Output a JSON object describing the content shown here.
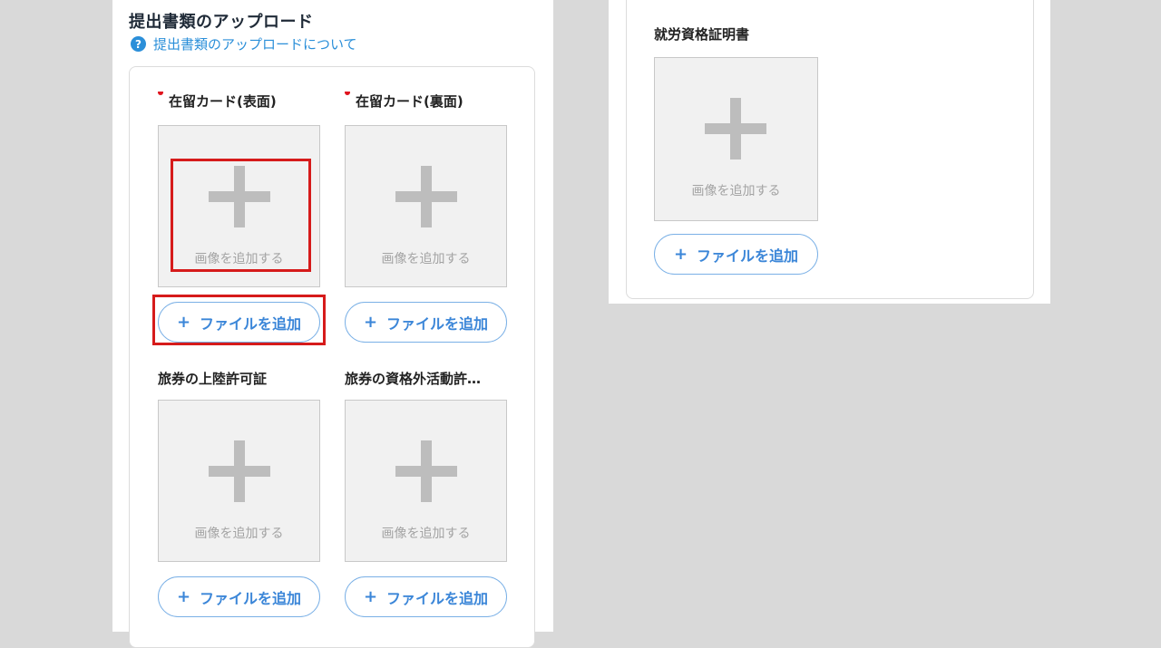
{
  "section": {
    "title": "提出書類のアップロード",
    "help_link": "提出書類のアップロードについて",
    "help_icon": "?"
  },
  "documents": [
    {
      "label": "在留カード(表面)",
      "required": true,
      "dropzone_text": "画像を追加する",
      "button_label": "ファイルを追加",
      "button_icon": "+"
    },
    {
      "label": "在留カード(裏面)",
      "required": true,
      "dropzone_text": "画像を追加する",
      "button_label": "ファイルを追加",
      "button_icon": "+"
    },
    {
      "label": "旅券の上陸許可証",
      "required": false,
      "dropzone_text": "画像を追加する",
      "button_label": "ファイルを追加",
      "button_icon": "+"
    },
    {
      "label": "旅券の資格外活動許…",
      "required": false,
      "dropzone_text": "画像を追加する",
      "button_label": "ファイルを追加",
      "button_icon": "+"
    }
  ],
  "right_documents": [
    {
      "label": "就労資格証明書",
      "required": false,
      "dropzone_text": "画像を追加する",
      "button_label": "ファイルを追加",
      "button_icon": "+"
    }
  ],
  "colors": {
    "accent": "#3b86d8",
    "required_dot": "#e0141e",
    "highlight": "#d61b1b",
    "dropzone_bg": "#f1f1f1"
  }
}
